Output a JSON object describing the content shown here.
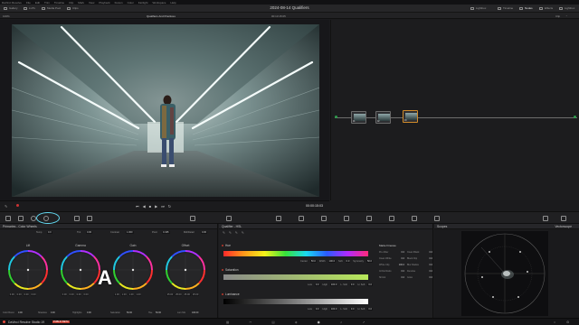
{
  "menubar": {
    "items": [
      "DaVinci Resolve",
      "File",
      "Edit",
      "Trim",
      "Timeline",
      "Clip",
      "Mark",
      "View",
      "Playback",
      "Fusion",
      "Color",
      "Fairlight",
      "Workspace",
      "Help"
    ]
  },
  "toolbar": {
    "left_items": [
      "Gallery",
      "LUTs",
      "Media Pool",
      "Clips"
    ],
    "project_title": "2024-08-14 Qualifiers",
    "right_items": [
      "Lightbox",
      "Timeline",
      "Nodes",
      "Effects",
      "Lightbox"
    ]
  },
  "subbar": {
    "zoom": "100%",
    "clip_name": "Qualifiers And Practices",
    "timecode": "00:13:15:05",
    "nodes_menu": "Clip"
  },
  "transport": {
    "timecode": "00:00:15:03"
  },
  "wheels_panel": {
    "title": "Primaries - Color Wheels",
    "params": [
      {
        "label": "Temp",
        "value": "0.0"
      },
      {
        "label": "Tint",
        "value": "0.00"
      },
      {
        "label": "Contrast",
        "value": "1.000"
      },
      {
        "label": "Pivot",
        "value": "0.435"
      },
      {
        "label": "Mid/Detail",
        "value": "0.00"
      }
    ],
    "wheels": [
      {
        "label": "Lift",
        "values": [
          "0.00",
          "0.00",
          "0.00",
          "0.00"
        ]
      },
      {
        "label": "Gamma",
        "values": [
          "0.00",
          "0.00",
          "0.00",
          "0.00"
        ]
      },
      {
        "label": "Gain",
        "values": [
          "1.00",
          "1.00",
          "1.00",
          "1.00"
        ]
      },
      {
        "label": "Offset",
        "values": [
          "25.00",
          "25.00",
          "25.00",
          "25.00"
        ]
      }
    ],
    "bottom_params": [
      {
        "label": "Color Boost",
        "value": "0.00"
      },
      {
        "label": "Shadows",
        "value": "0.00"
      },
      {
        "label": "Highlights",
        "value": "0.00"
      },
      {
        "label": "Saturation",
        "value": "50.00"
      },
      {
        "label": "Hue",
        "value": "50.00"
      },
      {
        "label": "Lum Mix",
        "value": "100.00"
      }
    ],
    "overlay_letter": "A"
  },
  "qualifier_panel": {
    "title": "Qualifier - HSL",
    "sections": [
      {
        "name": "Hue",
        "values": [
          {
            "label": "Center",
            "value": "50.0"
          },
          {
            "label": "Width",
            "value": "100.0"
          },
          {
            "label": "Soft",
            "value": "0.0"
          },
          {
            "label": "Symmetry",
            "value": "50.0"
          }
        ]
      },
      {
        "name": "Saturation",
        "values": [
          {
            "label": "Low",
            "value": "0.0"
          },
          {
            "label": "High",
            "value": "100.0"
          },
          {
            "label": "L. Soft",
            "value": "0.0"
          },
          {
            "label": "H. Soft",
            "value": "0.0"
          }
        ]
      },
      {
        "name": "Luminance",
        "values": [
          {
            "label": "Low",
            "value": "0.0"
          },
          {
            "label": "High",
            "value": "100.0"
          },
          {
            "label": "L. Soft",
            "value": "0.0"
          },
          {
            "label": "H. Soft",
            "value": "0.0"
          }
        ]
      }
    ],
    "matte_title": "Matte Finesse",
    "matte_rows": [
      {
        "label": "Pre-Filter",
        "value": "0.0"
      },
      {
        "label": "Clean Black",
        "value": "0.0"
      },
      {
        "label": "Clean White",
        "value": "0.0"
      },
      {
        "label": "Black Clip",
        "value": "0.0"
      },
      {
        "label": "White Clip",
        "value": "100.0"
      },
      {
        "label": "Blur Radius",
        "value": "0.0"
      },
      {
        "label": "In/Out Ratio",
        "value": "0.0"
      },
      {
        "label": "Denoise",
        "value": "0.0"
      },
      {
        "label": "Shrink",
        "value": "0.0"
      },
      {
        "label": "Grow",
        "value": "0.0"
      }
    ]
  },
  "scopes_panel": {
    "title": "Scopes",
    "mode": "Vectorscope"
  },
  "nodes": [
    {
      "num": "01"
    },
    {
      "num": "02"
    },
    {
      "num": "03"
    }
  ],
  "statusbar": {
    "app": "DaVinci Resolve Studio 19",
    "badge": "PUBLIC BETA"
  },
  "colors": {
    "accent": "#e64a3c",
    "highlight_ring": "#62d8f0",
    "panel_bg": "#1f1f21"
  }
}
